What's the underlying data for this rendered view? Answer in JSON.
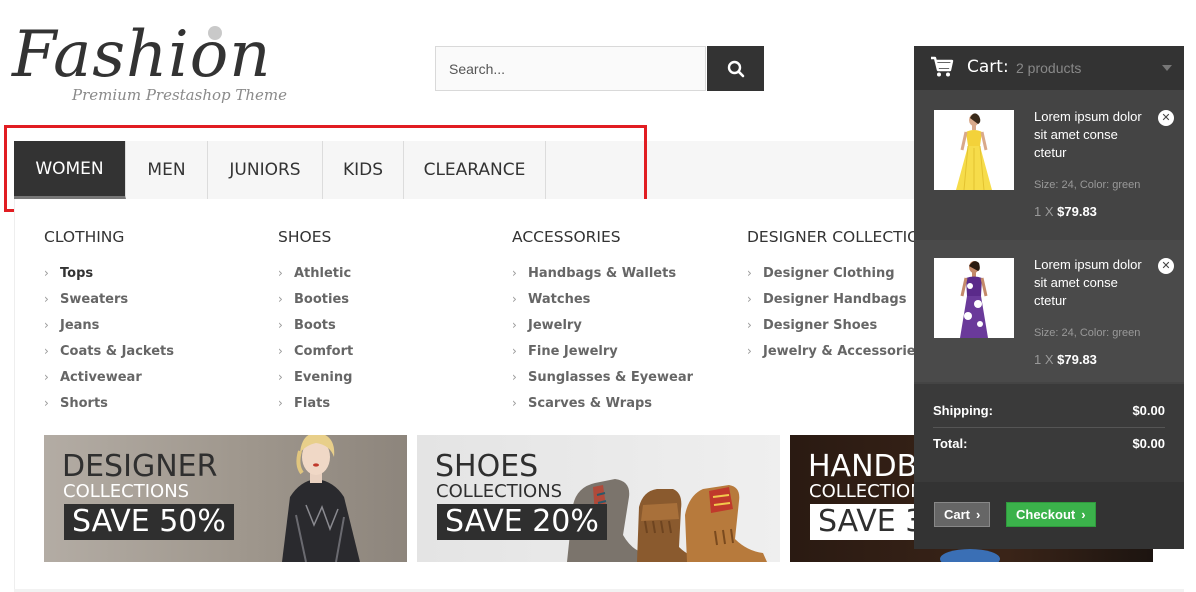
{
  "logo": {
    "title": "Fashion",
    "subtitle": "Premium Prestashop Theme"
  },
  "search": {
    "placeholder": "Search...",
    "icon": "search-icon"
  },
  "nav": {
    "items": [
      {
        "label": "WOMEN"
      },
      {
        "label": "MEN"
      },
      {
        "label": "JUNIORS"
      },
      {
        "label": "KIDS"
      },
      {
        "label": "CLEARANCE"
      }
    ]
  },
  "menu": {
    "columns": [
      {
        "title": "CLOTHING",
        "items": [
          "Tops",
          "Sweaters",
          "Jeans",
          "Coats & Jackets",
          "Activewear",
          "Shorts"
        ]
      },
      {
        "title": "SHOES",
        "items": [
          "Athletic",
          "Booties",
          "Boots",
          "Comfort",
          "Evening",
          "Flats"
        ]
      },
      {
        "title": "ACCESSORIES",
        "items": [
          "Handbags & Wallets",
          "Watches",
          "Jewelry",
          "Fine Jewelry",
          "Sunglasses & Eyewear",
          "Scarves & Wraps"
        ]
      },
      {
        "title": "DESIGNER COLLECTIO",
        "items": [
          "Designer Clothing",
          "Designer Handbags",
          "Designer Shoes",
          "Jewelry & Accessories"
        ]
      }
    ]
  },
  "banners": [
    {
      "title": "DESIGNER",
      "subtitle": "COLLECTIONS",
      "save": "SAVE 50%"
    },
    {
      "title": "SHOES",
      "subtitle": "COLLECTIONS",
      "save": "SAVE 20%"
    },
    {
      "title": "HANDB",
      "subtitle": "COLLECTION",
      "save": "SAVE 3"
    }
  ],
  "cart": {
    "label": "Cart:",
    "count": "2 products",
    "items": [
      {
        "name": "Lorem ipsum dolor sit amet conse ctetur",
        "attributes": "Size: 24, Color: green",
        "qty": "1 X",
        "price": "$79.83"
      },
      {
        "name": "Lorem ipsum dolor sit amet conse ctetur",
        "attributes": "Size: 24, Color: green",
        "qty": "1 X",
        "price": "$79.83"
      }
    ],
    "shipping_label": "Shipping:",
    "shipping_value": "$0.00",
    "total_label": "Total:",
    "total_value": "$0.00",
    "cart_button": "Cart",
    "checkout_button": "Checkout"
  },
  "colors": {
    "accent_dark": "#333333",
    "highlight": "#e11d22",
    "checkout_green": "#3bb24b"
  }
}
